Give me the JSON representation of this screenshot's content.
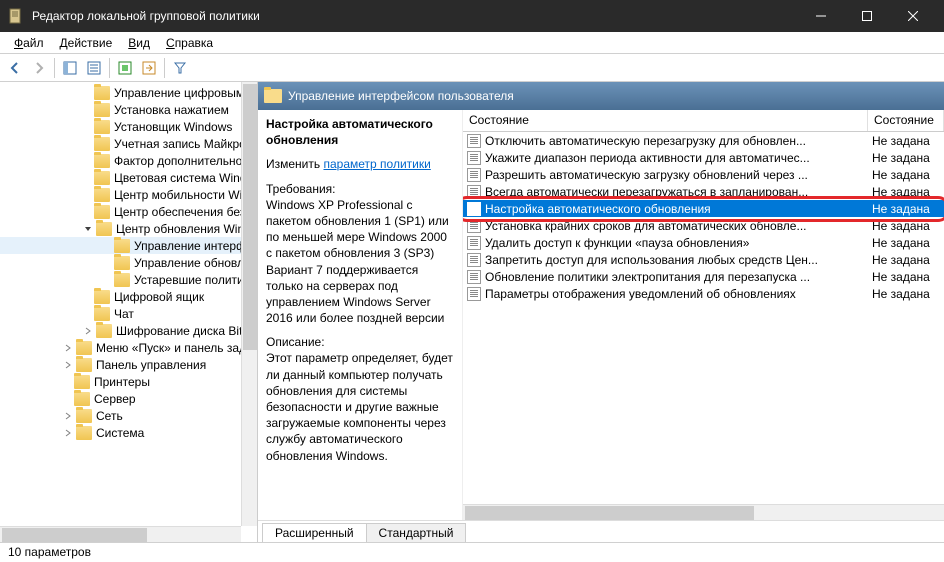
{
  "window": {
    "title": "Редактор локальной групповой политики"
  },
  "menu": {
    "file": "Файл",
    "action": "Действие",
    "view": "Вид",
    "help": "Справка"
  },
  "tree": [
    {
      "label": "Управление цифровым",
      "indent": 96
    },
    {
      "label": "Установка нажатием",
      "indent": 96
    },
    {
      "label": "Установщик Windows",
      "indent": 96
    },
    {
      "label": "Учетная запись Майкро",
      "indent": 96
    },
    {
      "label": "Фактор дополнительно",
      "indent": 96
    },
    {
      "label": "Цветовая система Wind",
      "indent": 96
    },
    {
      "label": "Центр мобильности Wi",
      "indent": 96
    },
    {
      "label": "Центр обеспечения без",
      "indent": 96
    },
    {
      "label": "Центр обновления Wind",
      "indent": 96,
      "expandable": true,
      "expanded": true
    },
    {
      "label": "Управление интерфе",
      "indent": 116,
      "selected": true
    },
    {
      "label": "Управление обновле",
      "indent": 116
    },
    {
      "label": "Устаревшие полити",
      "indent": 116
    },
    {
      "label": "Цифровой ящик",
      "indent": 96
    },
    {
      "label": "Чат",
      "indent": 96
    },
    {
      "label": "Шифрование диска BitL",
      "indent": 96,
      "expandable": true,
      "expanded": false
    },
    {
      "label": "Меню «Пуск» и панель зада",
      "indent": 76,
      "expandable": true,
      "expanded": false
    },
    {
      "label": "Панель управления",
      "indent": 76,
      "expandable": true,
      "expanded": false
    },
    {
      "label": "Принтеры",
      "indent": 76
    },
    {
      "label": "Сервер",
      "indent": 76
    },
    {
      "label": "Сеть",
      "indent": 76,
      "expandable": true,
      "expanded": false
    },
    {
      "label": "Система",
      "indent": 76,
      "expandable": true,
      "expanded": false
    }
  ],
  "detail": {
    "header": "Управление интерфейсом пользователя",
    "info_title": "Настройка автоматического обновления",
    "change_label": "Изменить",
    "policy_link": "параметр политики",
    "req_label": "Требования:",
    "req_text": "Windows XP Professional с пакетом обновления 1 (SP1) или по меньшей мере Windows 2000 с пакетом обновления 3 (SP3) Вариант 7 поддерживается только на серверах под управлением Windows Server 2016 или более поздней версии",
    "desc_label": "Описание:",
    "desc_text": "Этот параметр определяет, будет ли данный компьютер получать обновления для системы безопасности и другие важные загружаемые компоненты через службу автоматического обновления Windows.",
    "col_name": "Состояние",
    "col_state": "Состояние",
    "rows": [
      {
        "name": "Отключить автоматическую перезагрузку для обновлен...",
        "state": "Не задана"
      },
      {
        "name": "Укажите диапазон периода активности для автоматичес...",
        "state": "Не задана"
      },
      {
        "name": "Разрешить автоматическую загрузку обновлений через ...",
        "state": "Не задана"
      },
      {
        "name": "Всегда автоматически перезагружаться в запланирован...",
        "state": "Не задана"
      },
      {
        "name": "Настройка автоматического обновления",
        "state": "Не задана",
        "sel": true
      },
      {
        "name": "Установка крайних сроков для автоматических обновле...",
        "state": "Не задана"
      },
      {
        "name": "Удалить доступ к функции «пауза обновления»",
        "state": "Не задана"
      },
      {
        "name": "Запретить доступ для использования любых средств Цен...",
        "state": "Не задана"
      },
      {
        "name": "Обновление политики электропитания для перезапуска ...",
        "state": "Не задана"
      },
      {
        "name": "Параметры отображения уведомлений об обновлениях",
        "state": "Не задана"
      }
    ],
    "tabs": {
      "ext": "Расширенный",
      "std": "Стандартный"
    }
  },
  "status": "10 параметров"
}
